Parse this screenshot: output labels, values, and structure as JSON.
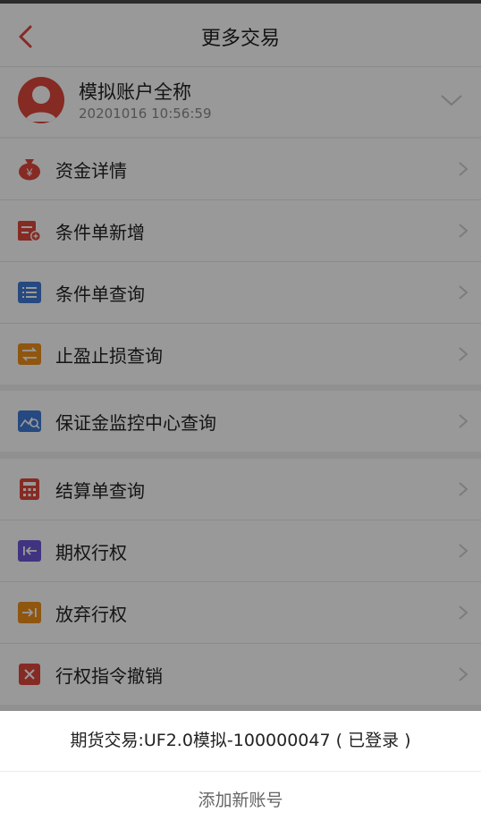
{
  "header": {
    "title": "更多交易"
  },
  "account": {
    "name": "模拟账户全称",
    "time": "20201016 10:56:59"
  },
  "menu": {
    "group1": [
      {
        "label": "资金详情",
        "icon": "money-bag-icon"
      },
      {
        "label": "条件单新增",
        "icon": "add-condition-icon"
      },
      {
        "label": "条件单查询",
        "icon": "list-icon"
      },
      {
        "label": "止盈止损查询",
        "icon": "swap-icon"
      }
    ],
    "group2": [
      {
        "label": "保证金监控中心查询",
        "icon": "chart-search-icon"
      }
    ],
    "group3": [
      {
        "label": "结算单查询",
        "icon": "calculator-icon"
      },
      {
        "label": "期权行权",
        "icon": "exercise-icon"
      },
      {
        "label": "放弃行权",
        "icon": "abandon-icon"
      },
      {
        "label": "行权指令撤销",
        "icon": "cancel-icon"
      }
    ]
  },
  "sheet": {
    "current_account": "期货交易:UF2.0模拟-100000047 ( 已登录 )",
    "add_account": "添加新账号"
  },
  "colors": {
    "accent": "#e0463c",
    "blue": "#3f7ad6",
    "orange": "#ef8f1c",
    "purple": "#6c58d8"
  }
}
